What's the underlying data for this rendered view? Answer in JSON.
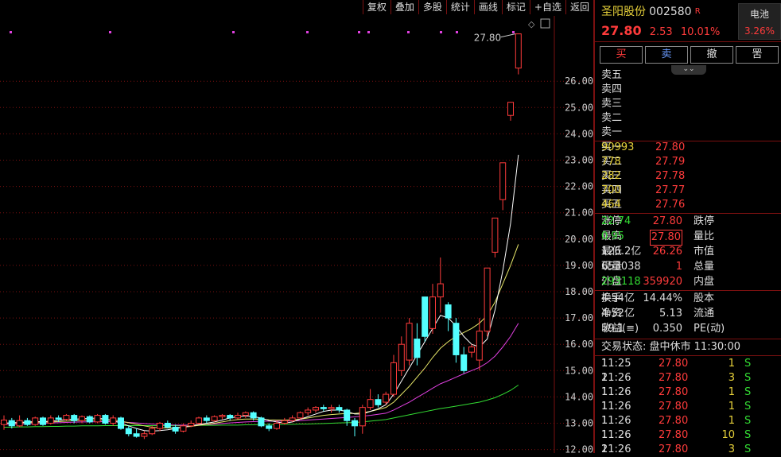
{
  "toolbar": {
    "items": [
      "复权",
      "叠加",
      "多股",
      "统计",
      "画线",
      "标记",
      "+自选",
      "返回"
    ]
  },
  "chart": {
    "high_marker": "27.80",
    "price_axis": [
      "26.00",
      "25.00",
      "24.00",
      "23.00",
      "22.00",
      "21.00",
      "20.00",
      "19.00",
      "18.00",
      "17.00",
      "16.00",
      "15.00",
      "14.00",
      "13.00",
      "12.00"
    ],
    "colors": {
      "up": "#ff3b3b",
      "down": "#54ffff",
      "ma5": "#ffffff",
      "ma10": "#e8e86a",
      "ma20": "#e040e0",
      "ma60": "#33dd33",
      "grid": "#7a1010"
    }
  },
  "chart_data": {
    "type": "candlestick",
    "ylim": [
      12,
      27.8
    ],
    "candles": [
      {
        "o": 12.95,
        "c": 13.12,
        "h": 13.3,
        "l": 12.75
      },
      {
        "o": 13.1,
        "c": 12.9,
        "h": 13.2,
        "l": 12.8
      },
      {
        "o": 12.9,
        "c": 13.1,
        "h": 13.3,
        "l": 12.85
      },
      {
        "o": 13.1,
        "c": 12.95,
        "h": 13.2,
        "l": 12.9
      },
      {
        "o": 12.95,
        "c": 13.2,
        "h": 13.25,
        "l": 12.9
      },
      {
        "o": 13.2,
        "c": 12.95,
        "h": 13.25,
        "l": 12.9
      },
      {
        "o": 13.0,
        "c": 13.2,
        "h": 13.3,
        "l": 12.95
      },
      {
        "o": 13.2,
        "c": 13.15,
        "h": 13.3,
        "l": 13.05
      },
      {
        "o": 13.15,
        "c": 13.3,
        "h": 13.35,
        "l": 13.1
      },
      {
        "o": 13.3,
        "c": 13.1,
        "h": 13.35,
        "l": 13.0
      },
      {
        "o": 13.1,
        "c": 13.25,
        "h": 13.3,
        "l": 13.0
      },
      {
        "o": 13.25,
        "c": 13.05,
        "h": 13.3,
        "l": 13.0
      },
      {
        "o": 13.05,
        "c": 13.3,
        "h": 13.35,
        "l": 13.0
      },
      {
        "o": 13.3,
        "c": 13.0,
        "h": 13.35,
        "l": 12.95
      },
      {
        "o": 13.0,
        "c": 13.2,
        "h": 13.3,
        "l": 12.9
      },
      {
        "o": 13.2,
        "c": 12.8,
        "h": 13.25,
        "l": 12.75
      },
      {
        "o": 12.8,
        "c": 12.6,
        "h": 12.9,
        "l": 12.5
      },
      {
        "o": 12.6,
        "c": 12.5,
        "h": 12.8,
        "l": 12.45
      },
      {
        "o": 12.5,
        "c": 12.6,
        "h": 12.7,
        "l": 12.4
      },
      {
        "o": 12.6,
        "c": 12.8,
        "h": 12.9,
        "l": 12.55
      },
      {
        "o": 12.8,
        "c": 13.0,
        "h": 13.05,
        "l": 12.7
      },
      {
        "o": 13.0,
        "c": 12.85,
        "h": 13.1,
        "l": 12.8
      },
      {
        "o": 12.85,
        "c": 12.7,
        "h": 12.95,
        "l": 12.6
      },
      {
        "o": 12.7,
        "c": 12.9,
        "h": 13.0,
        "l": 12.65
      },
      {
        "o": 12.9,
        "c": 13.0,
        "h": 13.1,
        "l": 12.85
      },
      {
        "o": 13.0,
        "c": 13.2,
        "h": 13.25,
        "l": 12.95
      },
      {
        "o": 13.2,
        "c": 13.1,
        "h": 13.3,
        "l": 13.0
      },
      {
        "o": 13.1,
        "c": 13.25,
        "h": 13.3,
        "l": 13.05
      },
      {
        "o": 13.25,
        "c": 13.3,
        "h": 13.35,
        "l": 13.15
      },
      {
        "o": 13.3,
        "c": 13.2,
        "h": 13.35,
        "l": 13.1
      },
      {
        "o": 13.2,
        "c": 13.3,
        "h": 13.4,
        "l": 13.15
      },
      {
        "o": 13.3,
        "c": 13.4,
        "h": 13.45,
        "l": 13.2
      },
      {
        "o": 13.4,
        "c": 13.2,
        "h": 13.45,
        "l": 13.1
      },
      {
        "o": 13.2,
        "c": 12.9,
        "h": 13.25,
        "l": 12.85
      },
      {
        "o": 12.9,
        "c": 12.8,
        "h": 13.0,
        "l": 12.7
      },
      {
        "o": 12.8,
        "c": 13.0,
        "h": 13.1,
        "l": 12.75
      },
      {
        "o": 13.0,
        "c": 13.1,
        "h": 13.2,
        "l": 12.95
      },
      {
        "o": 13.1,
        "c": 13.2,
        "h": 13.3,
        "l": 13.05
      },
      {
        "o": 13.2,
        "c": 13.4,
        "h": 13.45,
        "l": 13.15
      },
      {
        "o": 13.4,
        "c": 13.5,
        "h": 13.6,
        "l": 13.3
      },
      {
        "o": 13.5,
        "c": 13.6,
        "h": 13.65,
        "l": 13.4
      },
      {
        "o": 13.6,
        "c": 13.55,
        "h": 13.7,
        "l": 13.45
      },
      {
        "o": 13.55,
        "c": 13.6,
        "h": 13.7,
        "l": 13.4
      },
      {
        "o": 13.6,
        "c": 13.5,
        "h": 13.7,
        "l": 13.4
      },
      {
        "o": 13.5,
        "c": 13.1,
        "h": 13.55,
        "l": 12.9
      },
      {
        "o": 13.1,
        "c": 12.9,
        "h": 13.2,
        "l": 12.5
      },
      {
        "o": 12.9,
        "c": 13.6,
        "h": 13.7,
        "l": 12.6
      },
      {
        "o": 13.6,
        "c": 13.9,
        "h": 14.3,
        "l": 13.5
      },
      {
        "o": 13.9,
        "c": 13.7,
        "h": 14.1,
        "l": 13.6
      },
      {
        "o": 13.8,
        "c": 14.1,
        "h": 14.2,
        "l": 13.7
      },
      {
        "o": 14.1,
        "c": 15.3,
        "h": 15.6,
        "l": 14.0
      },
      {
        "o": 15.0,
        "c": 16.0,
        "h": 16.3,
        "l": 14.8
      },
      {
        "o": 15.4,
        "c": 16.8,
        "h": 17.0,
        "l": 15.2
      },
      {
        "o": 16.2,
        "c": 15.5,
        "h": 16.8,
        "l": 15.2
      },
      {
        "o": 17.8,
        "c": 16.3,
        "h": 17.8,
        "l": 16.1
      },
      {
        "o": 16.6,
        "c": 17.8,
        "h": 18.3,
        "l": 16.4
      },
      {
        "o": 17.8,
        "c": 18.3,
        "h": 19.3,
        "l": 17.2
      },
      {
        "o": 17.5,
        "c": 17.0,
        "h": 17.6,
        "l": 16.5
      },
      {
        "o": 16.8,
        "c": 15.6,
        "h": 17.0,
        "l": 15.3
      },
      {
        "o": 15.6,
        "c": 15.0,
        "h": 15.9,
        "l": 14.9
      },
      {
        "o": 15.7,
        "c": 15.9,
        "h": 16.0,
        "l": 15.5
      },
      {
        "o": 15.4,
        "c": 16.5,
        "h": 17.0,
        "l": 15.0
      },
      {
        "o": 16.5,
        "c": 18.9,
        "h": 18.9,
        "l": 16.3
      },
      {
        "o": 19.5,
        "c": 20.8,
        "h": 20.8,
        "l": 19.3
      },
      {
        "o": 21.5,
        "c": 22.9,
        "h": 22.9,
        "l": 21.1
      },
      {
        "o": 24.7,
        "c": 25.2,
        "h": 25.2,
        "l": 24.5
      },
      {
        "o": 26.5,
        "c": 27.8,
        "h": 27.8,
        "l": 26.26
      }
    ],
    "ma5": [
      13.0,
      13.02,
      13.03,
      13.05,
      13.06,
      13.06,
      13.08,
      13.1,
      13.15,
      13.15,
      13.17,
      13.18,
      13.2,
      13.15,
      13.1,
      13.0,
      12.9,
      12.8,
      12.72,
      12.7,
      12.72,
      12.75,
      12.8,
      12.85,
      12.9,
      12.95,
      13.0,
      13.05,
      13.12,
      13.2,
      13.25,
      13.28,
      13.25,
      13.2,
      13.1,
      13.05,
      13.0,
      13.05,
      13.15,
      13.25,
      13.35,
      13.45,
      13.5,
      13.5,
      13.45,
      13.35,
      13.35,
      13.45,
      13.55,
      13.7,
      14.1,
      14.6,
      15.1,
      15.6,
      16.1,
      16.6,
      17.1,
      17.0,
      16.7,
      16.3,
      16.0,
      15.9,
      16.2,
      17.3,
      18.8,
      20.6,
      23.2
    ],
    "ma10": [
      13.0,
      13.0,
      13.01,
      13.02,
      13.03,
      13.04,
      13.05,
      13.06,
      13.08,
      13.1,
      13.1,
      13.12,
      13.13,
      13.13,
      13.12,
      13.08,
      13.02,
      12.96,
      12.9,
      12.85,
      12.83,
      12.82,
      12.83,
      12.85,
      12.88,
      12.92,
      12.96,
      13.0,
      13.05,
      13.1,
      13.14,
      13.16,
      13.16,
      13.15,
      13.13,
      13.12,
      13.12,
      13.13,
      13.15,
      13.2,
      13.25,
      13.3,
      13.33,
      13.35,
      13.37,
      13.37,
      13.4,
      13.45,
      13.52,
      13.6,
      13.8,
      14.1,
      14.4,
      14.75,
      15.1,
      15.5,
      15.85,
      16.1,
      16.3,
      16.45,
      16.6,
      16.8,
      17.1,
      17.6,
      18.3,
      19.0,
      19.8
    ],
    "ma20": [
      12.95,
      12.96,
      12.97,
      12.98,
      12.99,
      13.0,
      13.01,
      13.02,
      13.03,
      13.04,
      13.05,
      13.05,
      13.06,
      13.06,
      13.06,
      13.05,
      13.03,
      13.01,
      12.99,
      12.97,
      12.95,
      12.94,
      12.93,
      12.93,
      12.93,
      12.94,
      12.95,
      12.97,
      12.99,
      13.01,
      13.03,
      13.05,
      13.06,
      13.07,
      13.08,
      13.08,
      13.08,
      13.09,
      13.1,
      13.12,
      13.14,
      13.16,
      13.18,
      13.2,
      13.22,
      13.24,
      13.27,
      13.3,
      13.34,
      13.38,
      13.5,
      13.65,
      13.8,
      13.98,
      14.15,
      14.33,
      14.5,
      14.62,
      14.75,
      14.88,
      15.0,
      15.12,
      15.3,
      15.55,
      15.9,
      16.3,
      16.8
    ],
    "ma60": [
      12.85,
      12.85,
      12.86,
      12.86,
      12.87,
      12.87,
      12.88,
      12.88,
      12.89,
      12.89,
      12.9,
      12.9,
      12.9,
      12.91,
      12.91,
      12.91,
      12.91,
      12.91,
      12.91,
      12.91,
      12.91,
      12.91,
      12.91,
      12.91,
      12.92,
      12.92,
      12.92,
      12.92,
      12.93,
      12.93,
      12.93,
      12.94,
      12.94,
      12.95,
      12.95,
      12.95,
      12.96,
      12.96,
      12.97,
      12.97,
      12.98,
      12.99,
      13.0,
      13.01,
      13.02,
      13.03,
      13.05,
      13.08,
      13.11,
      13.14,
      13.2,
      13.26,
      13.32,
      13.38,
      13.44,
      13.5,
      13.56,
      13.6,
      13.65,
      13.7,
      13.75,
      13.8,
      13.88,
      13.97,
      14.1,
      14.25,
      14.45
    ]
  },
  "quote": {
    "name": "圣阳股份",
    "code": "002580",
    "flag": "R",
    "sector": "电池",
    "sector_pct": "3.26%",
    "price": "27.80",
    "change": "2.53",
    "change_pct": "10.01%",
    "buttons": [
      "买",
      "卖",
      "撤",
      "罟"
    ],
    "collapse_icon": "chevron-down",
    "asks": [
      {
        "label": "卖五",
        "price": "",
        "vol": ""
      },
      {
        "label": "卖四",
        "price": "",
        "vol": ""
      },
      {
        "label": "卖三",
        "price": "",
        "vol": ""
      },
      {
        "label": "卖二",
        "price": "",
        "vol": ""
      },
      {
        "label": "卖一",
        "price": "",
        "vol": ""
      }
    ],
    "bids": [
      {
        "label": "买一",
        "price": "27.80",
        "vol": "90993"
      },
      {
        "label": "买二",
        "price": "27.79",
        "vol": "778"
      },
      {
        "label": "买三",
        "price": "27.78",
        "vol": "282"
      },
      {
        "label": "买四",
        "price": "27.77",
        "vol": "700"
      },
      {
        "label": "买五",
        "price": "27.76",
        "vol": "464"
      }
    ],
    "stats1": [
      {
        "l1": "涨停",
        "v1": "27.80",
        "l2": "跌停",
        "v2": "22.74"
      },
      {
        "l1": "最高",
        "v1": "27.80",
        "l2": "量比",
        "v2": "0.95"
      },
      {
        "l1": "最低",
        "v1": "26.26",
        "l2": "市值",
        "v2": "126.2亿"
      },
      {
        "l1": "现量",
        "v1": "1",
        "l2": "总量",
        "v2": "653038"
      },
      {
        "l1": "外盘",
        "v1": "359920",
        "l2": "内盘",
        "v2": "293118"
      }
    ],
    "stats2": [
      {
        "l1": "换手",
        "v1": "14.44%",
        "l2": "股本",
        "v2": "4.54亿"
      },
      {
        "l1": "净资",
        "v1": "5.13",
        "l2": "流通",
        "v2": "4.52亿"
      },
      {
        "l1": "收益(≡)",
        "v1": "0.350",
        "l2": "PE(动)",
        "v2": "59.1"
      }
    ],
    "status_label": "交易状态:",
    "status_value": "盘中休市 11:30:00",
    "ticks": [
      {
        "t": "11:25",
        "p": "27.80",
        "v": "1",
        "s": "S",
        "n": "1"
      },
      {
        "t": "11:26",
        "p": "27.80",
        "v": "3",
        "s": "S",
        "n": "2"
      },
      {
        "t": "11:26",
        "p": "27.80",
        "v": "1",
        "s": "S",
        "n": "1"
      },
      {
        "t": "11:26",
        "p": "27.80",
        "v": "1",
        "s": "S",
        "n": "1"
      },
      {
        "t": "11:26",
        "p": "27.80",
        "v": "1",
        "s": "S",
        "n": "1"
      },
      {
        "t": "11:26",
        "p": "27.80",
        "v": "10",
        "s": "S",
        "n": "1"
      },
      {
        "t": "11:26",
        "p": "27.80",
        "v": "3",
        "s": "S",
        "n": "2"
      }
    ]
  }
}
